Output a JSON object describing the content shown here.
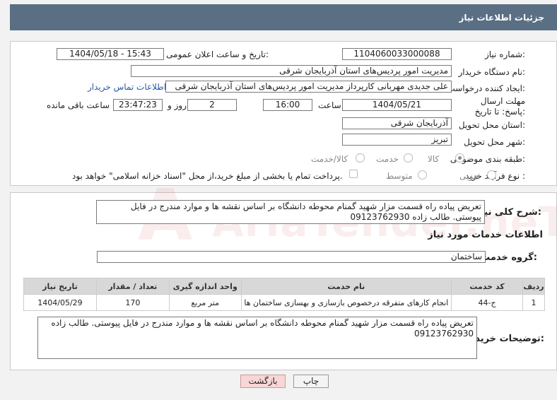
{
  "header": {
    "title": "جزئیات اطلاعات نیاز"
  },
  "fields": {
    "need_number_label": "شماره نیاز:",
    "need_number": "1104060033000088",
    "announce_label": "تاریخ و ساعت اعلان عمومی:",
    "announce_value": "1404/05/18 - 15:43",
    "buyer_label": "نام دستگاه خریدار:",
    "buyer": "مدیریت امور پردیس‌های استان آذربایجان شرقی",
    "creator_label": "ایجاد کننده درخواست:",
    "creator": "علی جدیدی مهربانی کارپرداز مدیریت امور پردیس‌های استان آذربایجان شرقی",
    "contact_link": "اطلاعات تماس خریدار",
    "deadline_label": "مهلت ارسال پاسخ: تا تاریخ:",
    "deadline_date": "1404/05/21",
    "time_label": "ساعت",
    "deadline_time": "16:00",
    "days_value": "2",
    "days_label": "روز و",
    "remaining_time": "23:47:23",
    "remaining_label": "ساعت باقی مانده",
    "province_label": "استان محل تحویل:",
    "province": "آذربایجان شرقی",
    "city_label": "شهر محل تحویل:",
    "city": "تبریز",
    "category_label": "طبقه بندی موضوعی:",
    "category_options": [
      "کالا",
      "خدمت",
      "کالا/خدمت"
    ],
    "process_label": "نوع فرآیند خرید :",
    "process_options": [
      "جزیی",
      "متوسط"
    ],
    "payment_note": "پرداخت تمام یا بخشی از مبلغ خرید،از محل \"اسناد خزانه اسلامی\" خواهد بود."
  },
  "summary": {
    "label": "شرح کلی نیاز:",
    "text": "تعریض پیاده راه قسمت مزار شهید گمنام محوطه دانشگاه بر اساس نقشه ها و موارد مندرج در فایل پیوستی. طالب زاده 09123762930"
  },
  "services": {
    "section_title": "اطلاعات خدمات مورد نیاز",
    "group_label": "گروه خدمت:",
    "group_value": "ساختمان",
    "columns": [
      "ردیف",
      "کد خدمت",
      "نام خدمت",
      "واحد اندازه گیری",
      "تعداد / مقدار",
      "تاریخ نیاز"
    ],
    "rows": [
      {
        "row": "1",
        "code": "ج-44",
        "name": "انجام کارهای متفرقه درخصوص بازسازی و بهسازی ساختمان ها",
        "unit": "متر مربع",
        "qty": "170",
        "date": "1404/05/29"
      }
    ]
  },
  "buyer_notes": {
    "label": "توضیحات خریدار:",
    "text": "تعریض پیاده راه قسمت مزار شهید گمنام محوطه دانشگاه بر اساس نقشه ها و موارد مندرج در فایل پیوستی. طالب زاده 09123762930"
  },
  "buttons": {
    "print": "چاپ",
    "back": "بازگشت"
  },
  "watermark": "AriaTender.neT"
}
